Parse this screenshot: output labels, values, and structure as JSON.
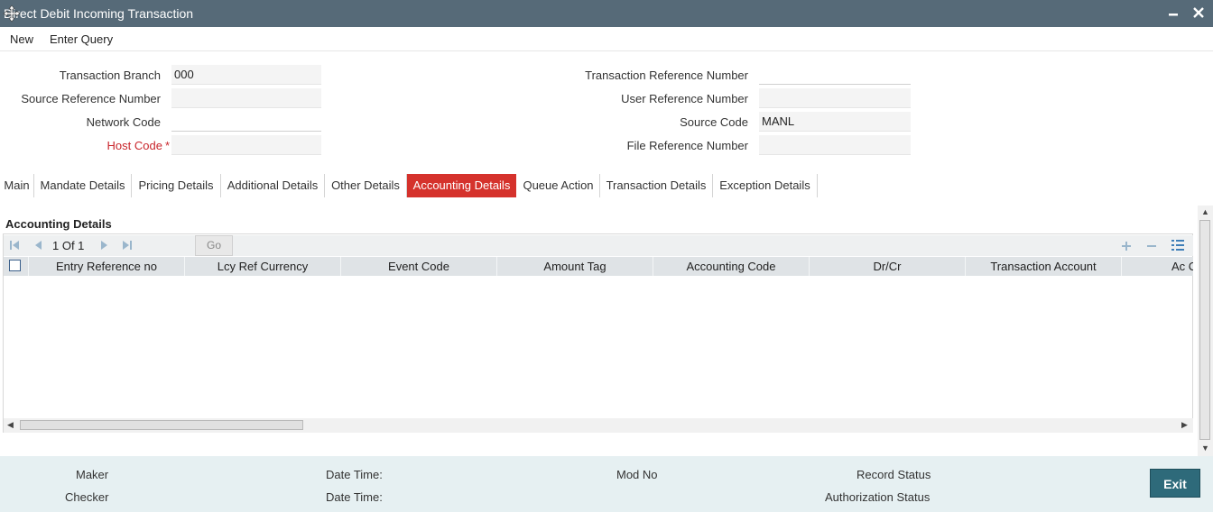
{
  "window": {
    "title": "Direct Debit Incoming Transaction"
  },
  "menu": {
    "new": "New",
    "enter_query": "Enter Query"
  },
  "fields": {
    "transaction_branch": {
      "label": "Transaction Branch",
      "value": "000"
    },
    "source_reference_number": {
      "label": "Source Reference Number",
      "value": ""
    },
    "network_code": {
      "label": "Network Code",
      "value": ""
    },
    "host_code": {
      "label": "Host Code",
      "required_mark": "*",
      "value": ""
    },
    "transaction_reference_number": {
      "label": "Transaction Reference Number",
      "value": ""
    },
    "user_reference_number": {
      "label": "User Reference Number",
      "value": ""
    },
    "source_code": {
      "label": "Source Code",
      "value": "MANL"
    },
    "file_reference_number": {
      "label": "File Reference Number",
      "value": ""
    }
  },
  "tabs": [
    {
      "label": "Main"
    },
    {
      "label": "Mandate Details"
    },
    {
      "label": "Pricing Details"
    },
    {
      "label": "Additional Details"
    },
    {
      "label": "Other Details"
    },
    {
      "label": "Accounting Details",
      "active": true
    },
    {
      "label": "Queue Action"
    },
    {
      "label": "Transaction Details"
    },
    {
      "label": "Exception Details"
    }
  ],
  "accounting": {
    "section_title": "Accounting Details",
    "pager": {
      "page_text": "1 Of 1",
      "go_label": "Go"
    },
    "columns": [
      "Entry Reference no",
      "Lcy Ref Currency",
      "Event Code",
      "Amount Tag",
      "Accounting Code",
      "Dr/Cr",
      "Transaction Account",
      "Ac C"
    ],
    "rows": []
  },
  "footer": {
    "maker": "Maker",
    "checker": "Checker",
    "date_time_1": "Date Time:",
    "date_time_2": "Date Time:",
    "mod_no": "Mod No",
    "record_status": "Record Status",
    "authorization_status": "Authorization Status",
    "exit": "Exit"
  },
  "colors": {
    "titlebar": "#566a78",
    "active_tab": "#d5322c",
    "footer_bg": "#e6f0f2",
    "exit_button": "#2e6a7a",
    "required": "#c9262c"
  },
  "icons": {
    "move": "move-icon",
    "minimize": "minimize-icon",
    "close": "close-icon",
    "first": "first-page-icon",
    "prev": "prev-page-icon",
    "next": "next-page-icon",
    "last": "last-page-icon",
    "add": "add-row-icon",
    "remove": "remove-row-icon",
    "columns": "column-settings-icon"
  }
}
